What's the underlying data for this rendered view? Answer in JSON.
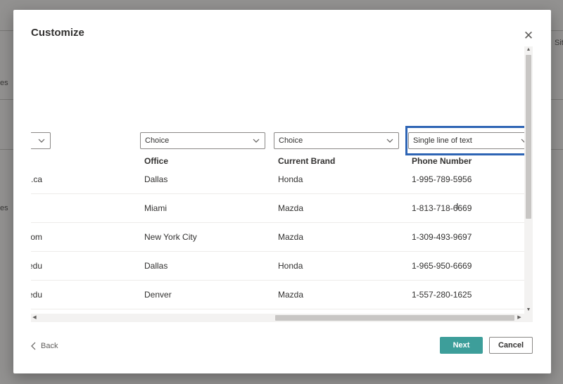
{
  "background": {
    "frag_top_right": "Sit",
    "frag_left_1": "es",
    "frag_left_2": "es"
  },
  "dialog": {
    "title": "Customize",
    "close_icon": "close-icon"
  },
  "columns": [
    {
      "type": "",
      "header": ""
    },
    {
      "type": "Choice",
      "header": "Office"
    },
    {
      "type": "Choice",
      "header": "Current Brand"
    },
    {
      "type": "Single line of text",
      "header": "Phone Number"
    }
  ],
  "rows": [
    {
      "email": "feugiat.tellus.lorem@mattis.ca",
      "office": "Dallas",
      "brand": "Honda",
      "phone": "1-995-789-5956"
    },
    {
      "email": "",
      "office": "Miami",
      "brand": "Mazda",
      "phone": "1-813-718-6669"
    },
    {
      "email": "lacus.etiam@natoque.com",
      "office": "New York City",
      "brand": "Mazda",
      "phone": "1-309-493-9697"
    },
    {
      "email": "ultrices.mauris@conubianostraper.edu",
      "office": "Dallas",
      "brand": "Honda",
      "phone": "1-965-950-6669"
    },
    {
      "email": "arcu.vestibulum@nlorem.edu",
      "office": "Denver",
      "brand": "Mazda",
      "phone": "1-557-280-1625"
    }
  ],
  "footer": {
    "back_label": "Back",
    "next_label": "Next",
    "cancel_label": "Cancel"
  },
  "colors": {
    "accent": "#3d9e9a",
    "highlight": "#2d64b4"
  }
}
